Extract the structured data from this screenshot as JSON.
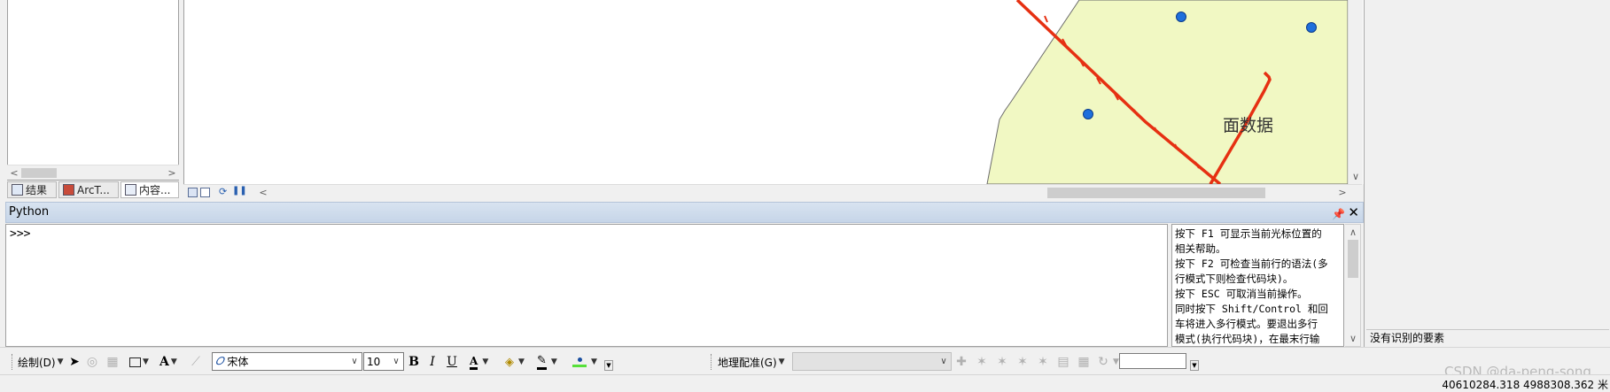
{
  "toc": {
    "tabs": [
      {
        "label": "结果",
        "icon": "results-icon"
      },
      {
        "label": "ArcT...",
        "icon": "arctoolbox-icon"
      },
      {
        "label": "内容...",
        "icon": "table-of-contents-icon"
      }
    ]
  },
  "map": {
    "polygon_label": "面数据",
    "colors": {
      "polygon_fill": "#f1f8c3",
      "polygon_outline": "#6b6b6b",
      "line": "#e63012",
      "point": "#1e6fdc"
    },
    "bottom_icons": [
      "layout-view-icon",
      "data-view-icon",
      "refresh-icon",
      "pause-drawing-icon"
    ]
  },
  "python_window": {
    "title": "Python",
    "prompt": ">>>",
    "help_lines": [
      "按下 F1 可显示当前光标位置的",
      "相关帮助。",
      "按下 F2 可检查当前行的语法(多",
      "行模式下则检查代码块)。",
      "按下 ESC 可取消当前操作。",
      "同时按下 Shift/Control 和回",
      "车将进入多行模式。要退出多行",
      "模式(执行代码块)，在最末行输"
    ]
  },
  "right_panel": {
    "status": "没有识别的要素"
  },
  "draw_toolbar": {
    "draw_menu": "绘制(D)",
    "font_name": "宋体",
    "font_size": "10",
    "bold": "B",
    "italic": "I",
    "underline": "U",
    "georef_menu": "地理配准(G)",
    "georef_layer": "",
    "georef_scale": ""
  },
  "status_bar": {
    "coordinates": "40610284.318  4988308.362 米"
  },
  "watermark": "CSDN @da-peng-song"
}
